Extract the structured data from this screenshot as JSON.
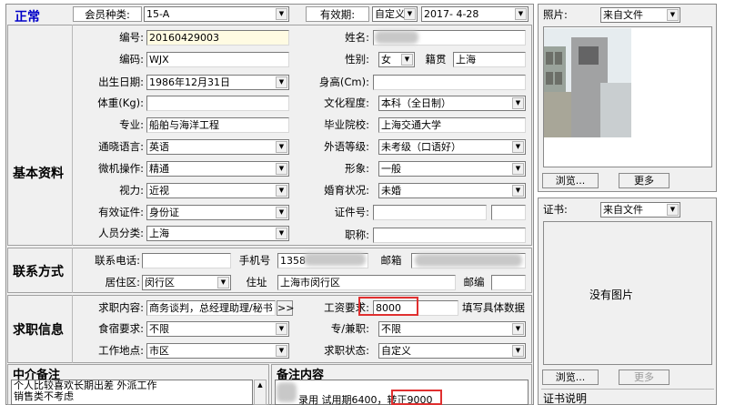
{
  "status": "正常",
  "top": {
    "member_type_label": "会员种类:",
    "member_type": "15-A",
    "validity_label": "有效期:",
    "validity_mode": "自定义",
    "validity_date": "2017- 4-28"
  },
  "basic": {
    "section_title": "基本资料",
    "id_label": "编号:",
    "id_value": "20160429003",
    "name_label": "姓名:",
    "code_label": "编码:",
    "code_value": "WJX",
    "gender_label": "性别:",
    "gender_value": "女",
    "origin_label": "籍贯",
    "origin_value": "上海",
    "birth_label": "出生日期:",
    "birth_value": "1986年12月31日",
    "height_label": "身高(Cm):",
    "weight_label": "体重(Kg):",
    "education_label": "文化程度:",
    "education_value": "本科（全日制）",
    "major_label": "专业:",
    "major_value": "船舶与海洋工程",
    "school_label": "毕业院校:",
    "school_value": "上海交通大学",
    "language_label": "通晓语言:",
    "language_value": "英语",
    "lang_level_label": "外语等级:",
    "lang_level_value": "未考级（口语好）",
    "computer_label": "微机操作:",
    "computer_value": "精通",
    "image_label": "形象:",
    "image_value": "一般",
    "vision_label": "视力:",
    "vision_value": "近视",
    "marital_label": "婚育状况:",
    "marital_value": "未婚",
    "idtype_label": "有效证件:",
    "idtype_value": "身份证",
    "idno_label": "证件号:",
    "category_label": "人员分类:",
    "category_value": "上海",
    "title_label": "职称:"
  },
  "contact": {
    "section_title": "联系方式",
    "phone_label": "联系电话:",
    "mobile_label": "手机号",
    "mobile_value": "1358",
    "email_label": "邮箱",
    "area_label": "居住区:",
    "area_value": "闵行区",
    "address_label": "住址",
    "address_value": "上海市闵行区",
    "zip_label": "邮编"
  },
  "job": {
    "section_title": "求职信息",
    "content_label": "求职内容:",
    "content_value": "商务谈判，总经理助理/秘书",
    "more_button": ">>",
    "salary_label": "工资要求:",
    "salary_value": "8000",
    "salary_hint": "填写具体数据",
    "food_label": "食宿要求:",
    "food_value": "不限",
    "fulltime_label": "专/兼职:",
    "fulltime_value": "不限",
    "workplace_label": "工作地点:",
    "workplace_value": "市区",
    "jobstatus_label": "求职状态:",
    "jobstatus_value": "自定义"
  },
  "photo": {
    "label": "照片:",
    "source": "来自文件",
    "browse": "浏览...",
    "more": "更多"
  },
  "cert": {
    "label": "证书:",
    "source": "来自文件",
    "placeholder": "没有图片",
    "browse": "浏览...",
    "more": "更多",
    "desc_label": "证书说明"
  },
  "agency_notes": {
    "title": "中介备注",
    "line1": "个人比较喜欢长期出差 外派工作",
    "line2": "销售类不考虑"
  },
  "remarks": {
    "title": "备注内容",
    "line1": "录用 试用期6400，",
    "highlight": "转正9000"
  },
  "colors": {
    "status_blue": "#0000c8",
    "highlight_red": "#e03030",
    "id_field_yellow": "#fffbe2"
  }
}
